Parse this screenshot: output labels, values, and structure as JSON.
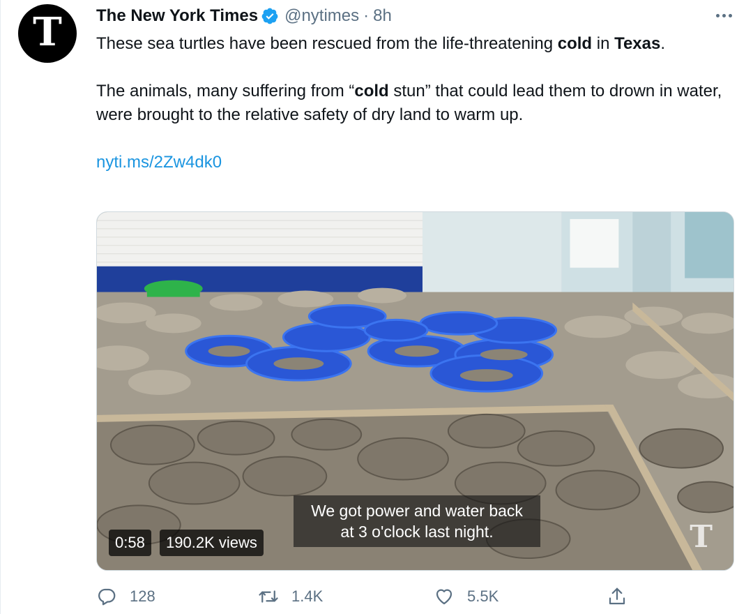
{
  "tweet": {
    "avatar_glyph": "T",
    "author_name": "The New York Times",
    "handle": "@nytimes",
    "separator": "·",
    "time": "8h",
    "text": {
      "p1_a": "These sea turtles have been rescued from the life-threatening ",
      "p1_bold1": "cold",
      "p1_b": " in ",
      "p1_bold2": "Texas",
      "p1_c": ".",
      "p2_a": "The animals, many suffering from “",
      "p2_bold": "cold",
      "p2_b": " stun” that could lead them to drown in water, were brought to the relative safety of dry land to warm up.",
      "link": "nyti.ms/2Zw4dk0"
    }
  },
  "video": {
    "caption_line1": "We got power and water back",
    "caption_line2": "at 3 o'clock last night.",
    "duration": "0:58",
    "views": "190.2K views",
    "watermark": "T"
  },
  "actions": {
    "reply_count": "128",
    "retweet_count": "1.4K",
    "like_count": "5.5K"
  },
  "icons": {
    "verified": "verified-badge-icon",
    "more": "more-options-icon",
    "reply": "reply-icon",
    "retweet": "retweet-icon",
    "like": "heart-icon",
    "share": "share-icon"
  },
  "colors": {
    "link": "#1b95e0",
    "verified": "#1da1f2",
    "muted": "#5b7083"
  }
}
